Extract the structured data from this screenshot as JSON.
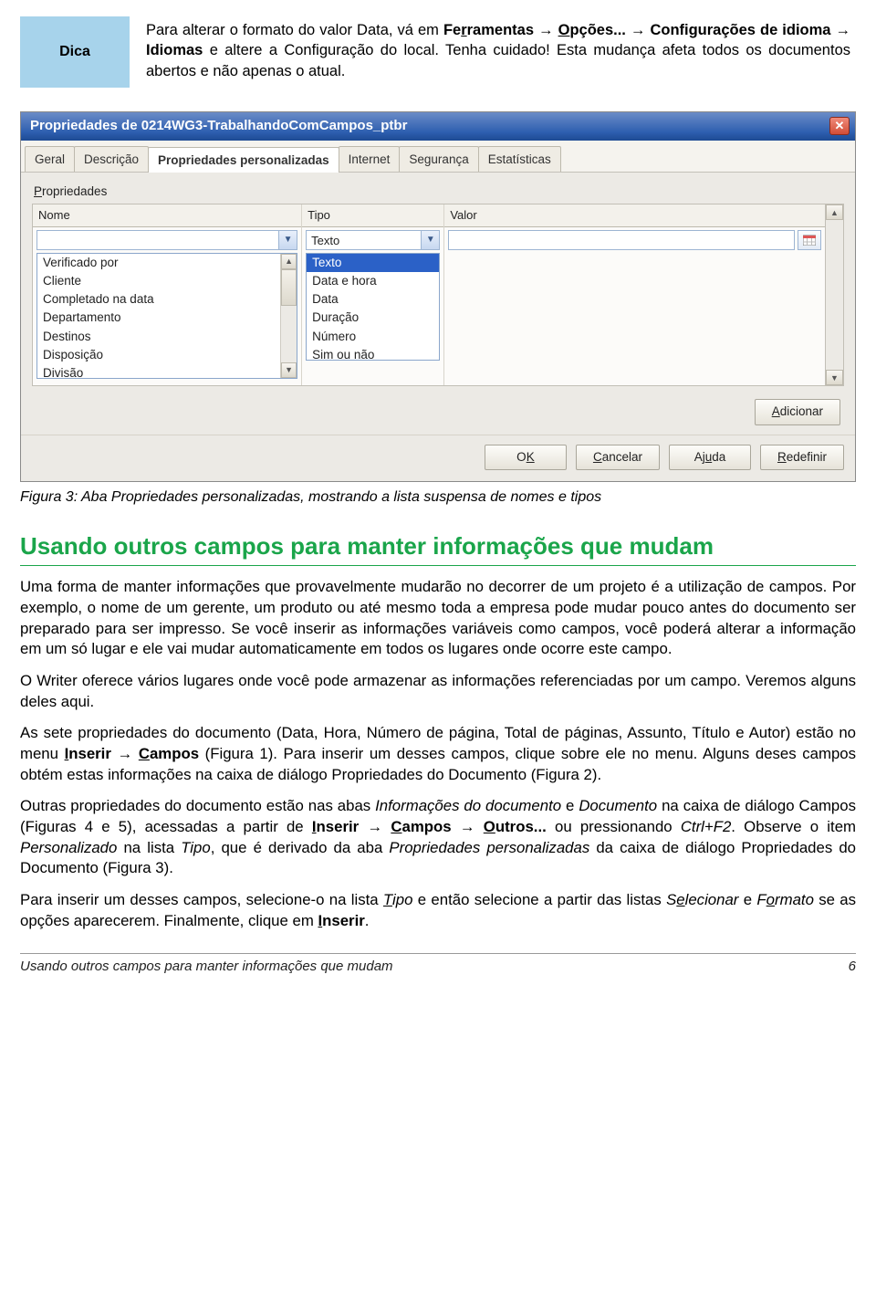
{
  "tip": {
    "label": "Dica",
    "text_parts": {
      "p1": "Para alterar o formato do valor Data, vá em ",
      "b1": "Fe_rramentas → _Opções... → Configurações de idioma → Idiomas",
      "p2": " e altere a Configuração do local. Tenha cuidado! Esta mudança afeta todos os documentos abertos e não apenas o atual."
    }
  },
  "dialog": {
    "title": "Propriedades de 0214WG3-TrabalhandoComCampos_ptbr",
    "tabs": [
      "Geral",
      "Descrição",
      "Propriedades personalizadas",
      "Internet",
      "Segurança",
      "Estatísticas"
    ],
    "active_tab": 2,
    "props_label": "Propriedades",
    "cols": {
      "nome": "Nome",
      "tipo": "Tipo",
      "valor": "Valor"
    },
    "nome_options": [
      "Verificado por",
      "Cliente",
      "Completado na data",
      "Departamento",
      "Destinos",
      "Disposição",
      "Divisão"
    ],
    "tipo_selected": "Texto",
    "tipo_options": [
      "Texto",
      "Data e hora",
      "Data",
      "Duração",
      "Número",
      "Sim ou não"
    ],
    "add_btn": "Adicionar",
    "ok": "OK",
    "cancel": "Cancelar",
    "help": "Ajuda",
    "reset": "Redefinir"
  },
  "caption": "Figura 3: Aba Propriedades personalizadas, mostrando a lista suspensa de nomes e tipos",
  "section_title": "Usando outros campos para manter informações que mudam",
  "paragraphs": {
    "p1": "Uma forma de manter informações que provavelmente mudarão no decorrer de um projeto é a utilização de campos. Por exemplo, o nome de um gerente, um produto ou até mesmo toda a empresa pode mudar pouco antes do documento ser preparado para ser impresso. Se você inserir as informações variáveis como campos, você poderá alterar a informação em um só lugar e ele vai mudar automaticamente em todos os lugares onde ocorre este campo.",
    "p2": "O Writer oferece vários lugares onde você pode armazenar as informações referenciadas por um campo. Veremos alguns deles aqui.",
    "p3a": "As sete propriedades do documento (Data, Hora, Número de página, Total de páginas, Assunto, Título e Autor) estão no menu ",
    "p3b": "Inserir → Campos",
    "p3c": " (Figura 1). Para inserir um desses campos, clique sobre ele no menu. Alguns deses campos obtém estas informações na caixa de diálogo Propriedades do Documento (Figura 2).",
    "p4a": "Outras propriedades do documento estão nas abas ",
    "p4b": "Informações do documento",
    "p4c": " e ",
    "p4d": "Documento",
    "p4e": " na caixa de diálogo Campos (Figuras 4 e 5), acessadas a partir de ",
    "p4f": "Inserir → Campos → Outros...",
    "p4g": " ou pressionando ",
    "p4h": "Ctrl+F2",
    "p4i": ". Observe o item ",
    "p4j": "Personalizado",
    "p4k": " na lista ",
    "p4l": "Tipo",
    "p4m": ", que é derivado da aba ",
    "p4n": "Propriedades personalizadas",
    "p4o": " da caixa de diálogo Propriedades do Documento (Figura 3).",
    "p5a": "Para inserir um desses campos, selecione-o na lista ",
    "p5b": "Tipo",
    "p5c": " e então selecione a partir das listas ",
    "p5d": "Selecionar",
    "p5e": " e ",
    "p5f": "Formato",
    "p5g": " se as opções aparecerem. Finalmente, clique em ",
    "p5h": "Inserir",
    "p5i": "."
  },
  "footer": {
    "left": "Usando outros campos para manter informações que mudam",
    "right": "6"
  }
}
